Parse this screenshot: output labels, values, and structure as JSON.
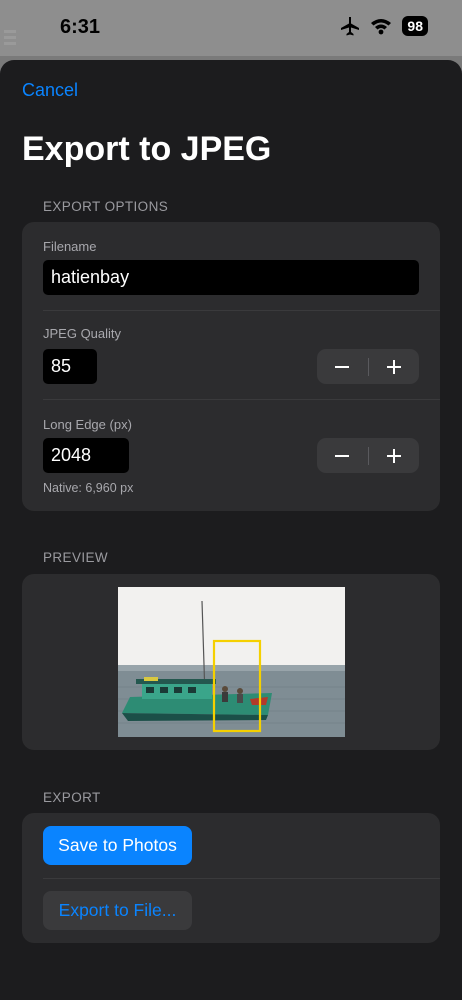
{
  "status_bar": {
    "time": "6:31",
    "battery": "98",
    "icons": [
      "airplane-icon",
      "wifi-icon",
      "battery-icon"
    ]
  },
  "sheet": {
    "cancel_label": "Cancel",
    "title": "Export to JPEG"
  },
  "export_options": {
    "header": "EXPORT OPTIONS",
    "filename_label": "Filename",
    "filename_value": "hatienbay",
    "quality_label": "JPEG Quality",
    "quality_value": "85",
    "long_edge_label": "Long Edge (px)",
    "long_edge_value": "2048",
    "native_hint": "Native: 6,960 px"
  },
  "preview": {
    "header": "PREVIEW"
  },
  "export": {
    "header": "EXPORT",
    "save_label": "Save to Photos",
    "file_label": "Export to File..."
  },
  "colors": {
    "accent": "#0a84ff",
    "sheet_bg": "#1c1c1e",
    "group_bg": "#2c2c2e",
    "crop_frame": "#f5d000"
  }
}
